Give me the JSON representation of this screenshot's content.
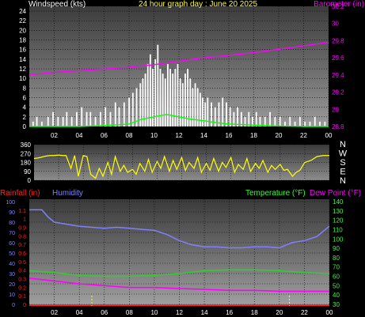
{
  "header": {
    "windspeed_label": "Windspeed (kts)",
    "title": "24 hour graph day : June 20 2025",
    "barometer_label": "Barometer (in)"
  },
  "lower": {
    "rainfall_label": "Rainfall (in)",
    "humidity_label": "Humidity",
    "temperature_label": "Temperature (°F)",
    "dewpoint_label": "Dew Point (°F)"
  },
  "colors": {
    "windspeed": "#ffffff",
    "wind_avg": "#00ff00",
    "barometer": "#ff00ff",
    "direction": "#ffff00",
    "rainfall": "#ff2020",
    "humidity": "#8080ff",
    "temperature": "#33cc33",
    "dewpoint": "#ff00ff",
    "marker": "#ffff00"
  },
  "chart_data": [
    {
      "type": "bar",
      "name_key": "windspeed",
      "xlabel": "",
      "x_tick_labels": [
        "02",
        "04",
        "06",
        "08",
        "10",
        "12",
        "14",
        "16",
        "18",
        "20",
        "22",
        "00"
      ],
      "ylim": [
        0,
        25
      ],
      "y_tick_labels": [
        "0",
        "2",
        "4",
        "6",
        "8",
        "10",
        "12",
        "14",
        "16",
        "18",
        "20",
        "22",
        "24"
      ],
      "series": [
        {
          "name": "Windspeed (kts)",
          "x_hours": [
            0.3,
            0.6,
            1.0,
            1.5,
            1.9,
            2.3,
            2.7,
            3.0,
            3.4,
            3.8,
            4.2,
            4.6,
            4.9,
            5.3,
            5.7,
            6.1,
            6.5,
            6.9,
            7.2,
            7.6,
            8.0,
            8.3,
            8.6,
            8.9,
            9.1,
            9.3,
            9.5,
            9.7,
            9.9,
            10.1,
            10.3,
            10.5,
            10.7,
            10.9,
            11.1,
            11.3,
            11.5,
            11.7,
            11.9,
            12.1,
            12.3,
            12.5,
            12.7,
            12.9,
            13.1,
            13.3,
            13.5,
            13.7,
            13.9,
            14.1,
            14.3,
            14.6,
            14.9,
            15.2,
            15.5,
            15.8,
            16.1,
            16.4,
            16.7,
            17.0,
            17.3,
            17.6,
            17.9,
            18.2,
            18.5,
            18.9,
            19.3,
            19.7,
            20.1,
            20.5,
            20.9,
            21.3,
            21.7,
            22.1,
            22.5,
            22.9,
            23.3,
            23.7
          ],
          "values": [
            1,
            2,
            1,
            2,
            3,
            2,
            2,
            3,
            2,
            3,
            4,
            3,
            3,
            2,
            3,
            4,
            3,
            5,
            4,
            5,
            6,
            7,
            8,
            9,
            10,
            11,
            13,
            15,
            12,
            14,
            17,
            12,
            11,
            10,
            13,
            12,
            11,
            12,
            13,
            10,
            9,
            11,
            12,
            10,
            8,
            9,
            8,
            7,
            6,
            5,
            6,
            5,
            4,
            5,
            6,
            5,
            4,
            3,
            4,
            3,
            2,
            3,
            2,
            3,
            2,
            2,
            3,
            2,
            2,
            1,
            2,
            1,
            2,
            1,
            1,
            2,
            1,
            1
          ]
        },
        {
          "name": "Average Wind",
          "x_hours": [
            0,
            4,
            6,
            8,
            9,
            10,
            11,
            12,
            13,
            14,
            15,
            16,
            18,
            20,
            22,
            24
          ],
          "values": [
            0,
            0,
            0.2,
            0.5,
            1.5,
            2.0,
            2.5,
            2.0,
            1.5,
            1.2,
            0.8,
            0.5,
            0.3,
            0.1,
            0,
            0
          ]
        }
      ]
    },
    {
      "type": "line",
      "name_key": "barometer",
      "ylim": [
        28.8,
        30.2
      ],
      "y_tick_labels": [
        "28.8",
        "29",
        "29.2",
        "29.4",
        "29.6",
        "29.8",
        "30",
        "30.2"
      ],
      "series": [
        {
          "name": "Barometer (in)",
          "x_hours": [
            0,
            2,
            4,
            6,
            8,
            10,
            12,
            14,
            16,
            18,
            20,
            22,
            24
          ],
          "values": [
            29.4,
            29.43,
            29.45,
            29.47,
            29.49,
            29.52,
            29.56,
            29.6,
            29.63,
            29.66,
            29.7,
            29.74,
            29.78
          ]
        }
      ]
    },
    {
      "type": "line",
      "name_key": "wind_direction",
      "ylim": [
        0,
        360
      ],
      "y_tick_labels": [
        "0",
        "90",
        "180",
        "270",
        "360"
      ],
      "compass_labels": [
        "N",
        "W",
        "S",
        "E",
        "N"
      ],
      "series": [
        {
          "name": "Wind Direction",
          "x_hours": [
            0.0,
            0.3,
            0.5,
            0.8,
            1.0,
            1.3,
            1.6,
            2.0,
            2.3,
            2.6,
            3.0,
            3.3,
            3.6,
            4.0,
            4.3,
            4.6,
            5.0,
            5.3,
            5.6,
            6.0,
            6.3,
            6.6,
            7.0,
            7.3,
            7.6,
            8.0,
            8.3,
            8.6,
            9.0,
            9.3,
            9.6,
            10.0,
            10.3,
            10.6,
            11.0,
            11.3,
            11.6,
            12.0,
            12.3,
            12.6,
            13.0,
            13.3,
            13.6,
            14.0,
            14.3,
            14.6,
            15.0,
            15.3,
            15.6,
            16.0,
            16.3,
            16.6,
            17.0,
            17.3,
            17.6,
            18.0,
            18.3,
            18.6,
            19.0,
            19.3,
            19.6,
            20.0,
            20.3,
            20.6,
            21.0,
            21.3,
            21.6,
            22.0,
            22.5,
            23.0,
            23.5,
            24.0
          ],
          "values": [
            220,
            225,
            230,
            240,
            245,
            250,
            250,
            255,
            250,
            250,
            120,
            250,
            40,
            250,
            240,
            60,
            20,
            120,
            40,
            180,
            60,
            240,
            90,
            150,
            80,
            110,
            60,
            170,
            90,
            210,
            80,
            190,
            120,
            240,
            90,
            200,
            110,
            230,
            100,
            180,
            120,
            230,
            80,
            170,
            100,
            220,
            90,
            180,
            130,
            230,
            80,
            160,
            110,
            220,
            90,
            170,
            120,
            200,
            80,
            150,
            110,
            160,
            100,
            110,
            40,
            80,
            100,
            180,
            200,
            240,
            250,
            250
          ]
        }
      ]
    },
    {
      "type": "line",
      "name_key": "humidity",
      "ylim": [
        0,
        100
      ],
      "y_tick_labels": [
        "0",
        "10",
        "20",
        "30",
        "40",
        "50",
        "60",
        "70",
        "80",
        "90",
        "100"
      ],
      "series": [
        {
          "name": "Humidity",
          "x_hours": [
            0,
            1,
            1.5,
            2,
            3,
            4,
            5,
            6,
            7,
            8,
            9,
            10,
            11,
            12,
            13,
            14,
            15,
            16,
            17,
            18,
            19,
            20,
            21,
            22,
            23,
            24
          ],
          "values": [
            92,
            92,
            85,
            80,
            78,
            76,
            75,
            74,
            75,
            74,
            73,
            72,
            68,
            62,
            58,
            56,
            56,
            55,
            55,
            56,
            56,
            55,
            60,
            62,
            66,
            76
          ]
        }
      ]
    },
    {
      "type": "line",
      "name_key": "temperature",
      "ylim": [
        30,
        140
      ],
      "y_tick_labels": [
        "30",
        "40",
        "50",
        "60",
        "70",
        "80",
        "90",
        "100",
        "110",
        "120",
        "130",
        "140"
      ],
      "series": [
        {
          "name": "Temperature (°F)",
          "x_hours": [
            0,
            2,
            4,
            6,
            8,
            10,
            12,
            14,
            16,
            18,
            20,
            22,
            24
          ],
          "values": [
            66,
            64,
            61,
            60,
            60,
            61,
            63,
            66,
            67,
            67,
            66,
            64,
            63
          ]
        },
        {
          "name": "Dew Point (°F)",
          "x_hours": [
            0,
            2,
            4,
            6,
            8,
            10,
            12,
            14,
            16,
            18,
            20,
            22,
            24
          ],
          "values": [
            58,
            55,
            52,
            50,
            48,
            48,
            47,
            46,
            45,
            45,
            44,
            44,
            44
          ]
        }
      ]
    },
    {
      "type": "line",
      "name_key": "rainfall",
      "ylim": [
        0,
        1.2
      ],
      "y_tick_labels": [
        "0",
        "0.1",
        "0.2",
        "0.3",
        "0.4",
        "0.5",
        "0.6",
        "0.7",
        "0.8",
        "0.9",
        "1",
        "1.1"
      ],
      "series": [
        {
          "name": "Rainfall (in)",
          "x_hours": [
            0,
            24
          ],
          "values": [
            0,
            0
          ]
        }
      ],
      "markers_x_hours": [
        5.0,
        20.8
      ]
    }
  ]
}
